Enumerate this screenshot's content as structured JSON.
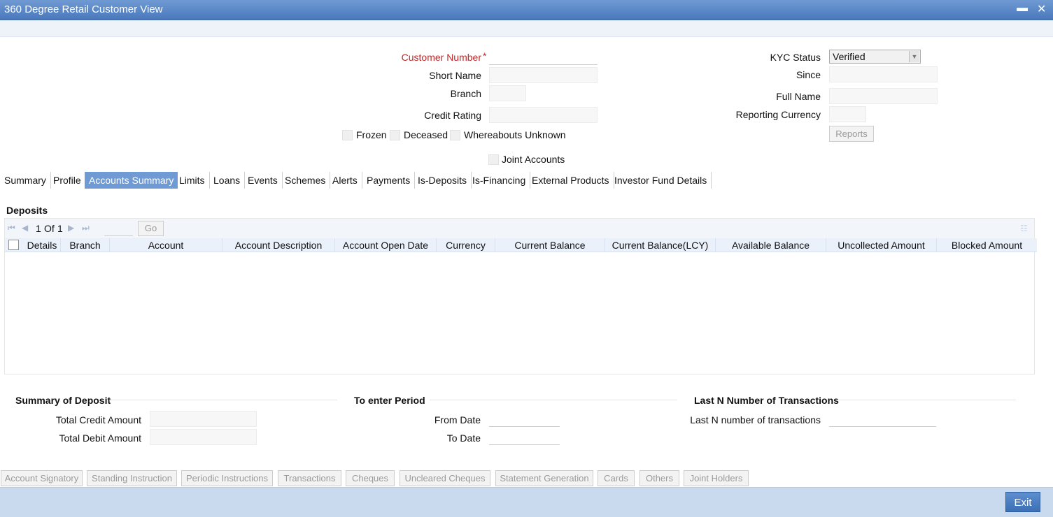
{
  "window": {
    "title": "360 Degree Retail Customer View",
    "minimize_glyph": "▬",
    "close_glyph": "✕"
  },
  "customer": {
    "customer_number_label": "Customer Number",
    "required_star": "*",
    "customer_number_value": "",
    "short_name_label": "Short Name",
    "short_name_value": "",
    "branch_label": "Branch",
    "branch_value": "",
    "credit_rating_label": "Credit Rating",
    "credit_rating_value": "",
    "kyc_status_label": "KYC Status",
    "kyc_status_value": "Verified",
    "since_label": "Since",
    "since_value": "",
    "full_name_label": "Full Name",
    "full_name_value": "",
    "reporting_currency_label": "Reporting Currency",
    "reporting_currency_value": "",
    "reports_button": "Reports",
    "frozen_label": "Frozen",
    "deceased_label": "Deceased",
    "whereabouts_label": "Whereabouts Unknown",
    "joint_accounts_label": "Joint Accounts"
  },
  "tabs": [
    {
      "label": "Summary"
    },
    {
      "label": "Profile"
    },
    {
      "label": "Accounts Summary",
      "active": true
    },
    {
      "label": "Limits"
    },
    {
      "label": "Loans"
    },
    {
      "label": "Events"
    },
    {
      "label": "Schemes"
    },
    {
      "label": "Alerts"
    },
    {
      "label": "Payments"
    },
    {
      "label": "Is-Deposits"
    },
    {
      "label": "Is-Financing"
    },
    {
      "label": "External Products"
    },
    {
      "label": "Investor Fund Details"
    }
  ],
  "deposits": {
    "heading": "Deposits",
    "pager": {
      "current": "1",
      "of_label": "Of",
      "total": "1",
      "go_label": "Go",
      "first_glyph": "⏮",
      "prev_glyph": "◀",
      "next_glyph": "▶",
      "last_glyph": "⏭",
      "grip_glyph": "☷"
    },
    "columns": [
      "Details",
      "Branch",
      "Account",
      "Account Description",
      "Account Open Date",
      "Currency",
      "Current Balance",
      "Current Balance(LCY)",
      "Available Balance",
      "Uncollected Amount",
      "Blocked Amount"
    ],
    "rows": []
  },
  "summary_of_deposit": {
    "heading": "Summary of Deposit",
    "total_credit_label": "Total Credit Amount",
    "total_credit_value": "",
    "total_debit_label": "Total Debit Amount",
    "total_debit_value": ""
  },
  "period": {
    "heading": "To enter Period",
    "from_label": "From Date",
    "from_value": "",
    "to_label": "To Date",
    "to_value": ""
  },
  "last_n": {
    "heading": "Last N Number of Transactions",
    "label": "Last N number of transactions",
    "value": ""
  },
  "bottom_buttons": [
    "Account Signatory",
    "Standing Instruction",
    "Periodic Instructions",
    "Transactions",
    "Cheques",
    "Uncleared Cheques",
    "Statement Generation",
    "Cards",
    "Others",
    "Joint Holders"
  ],
  "footer": {
    "exit_label": "Exit"
  }
}
